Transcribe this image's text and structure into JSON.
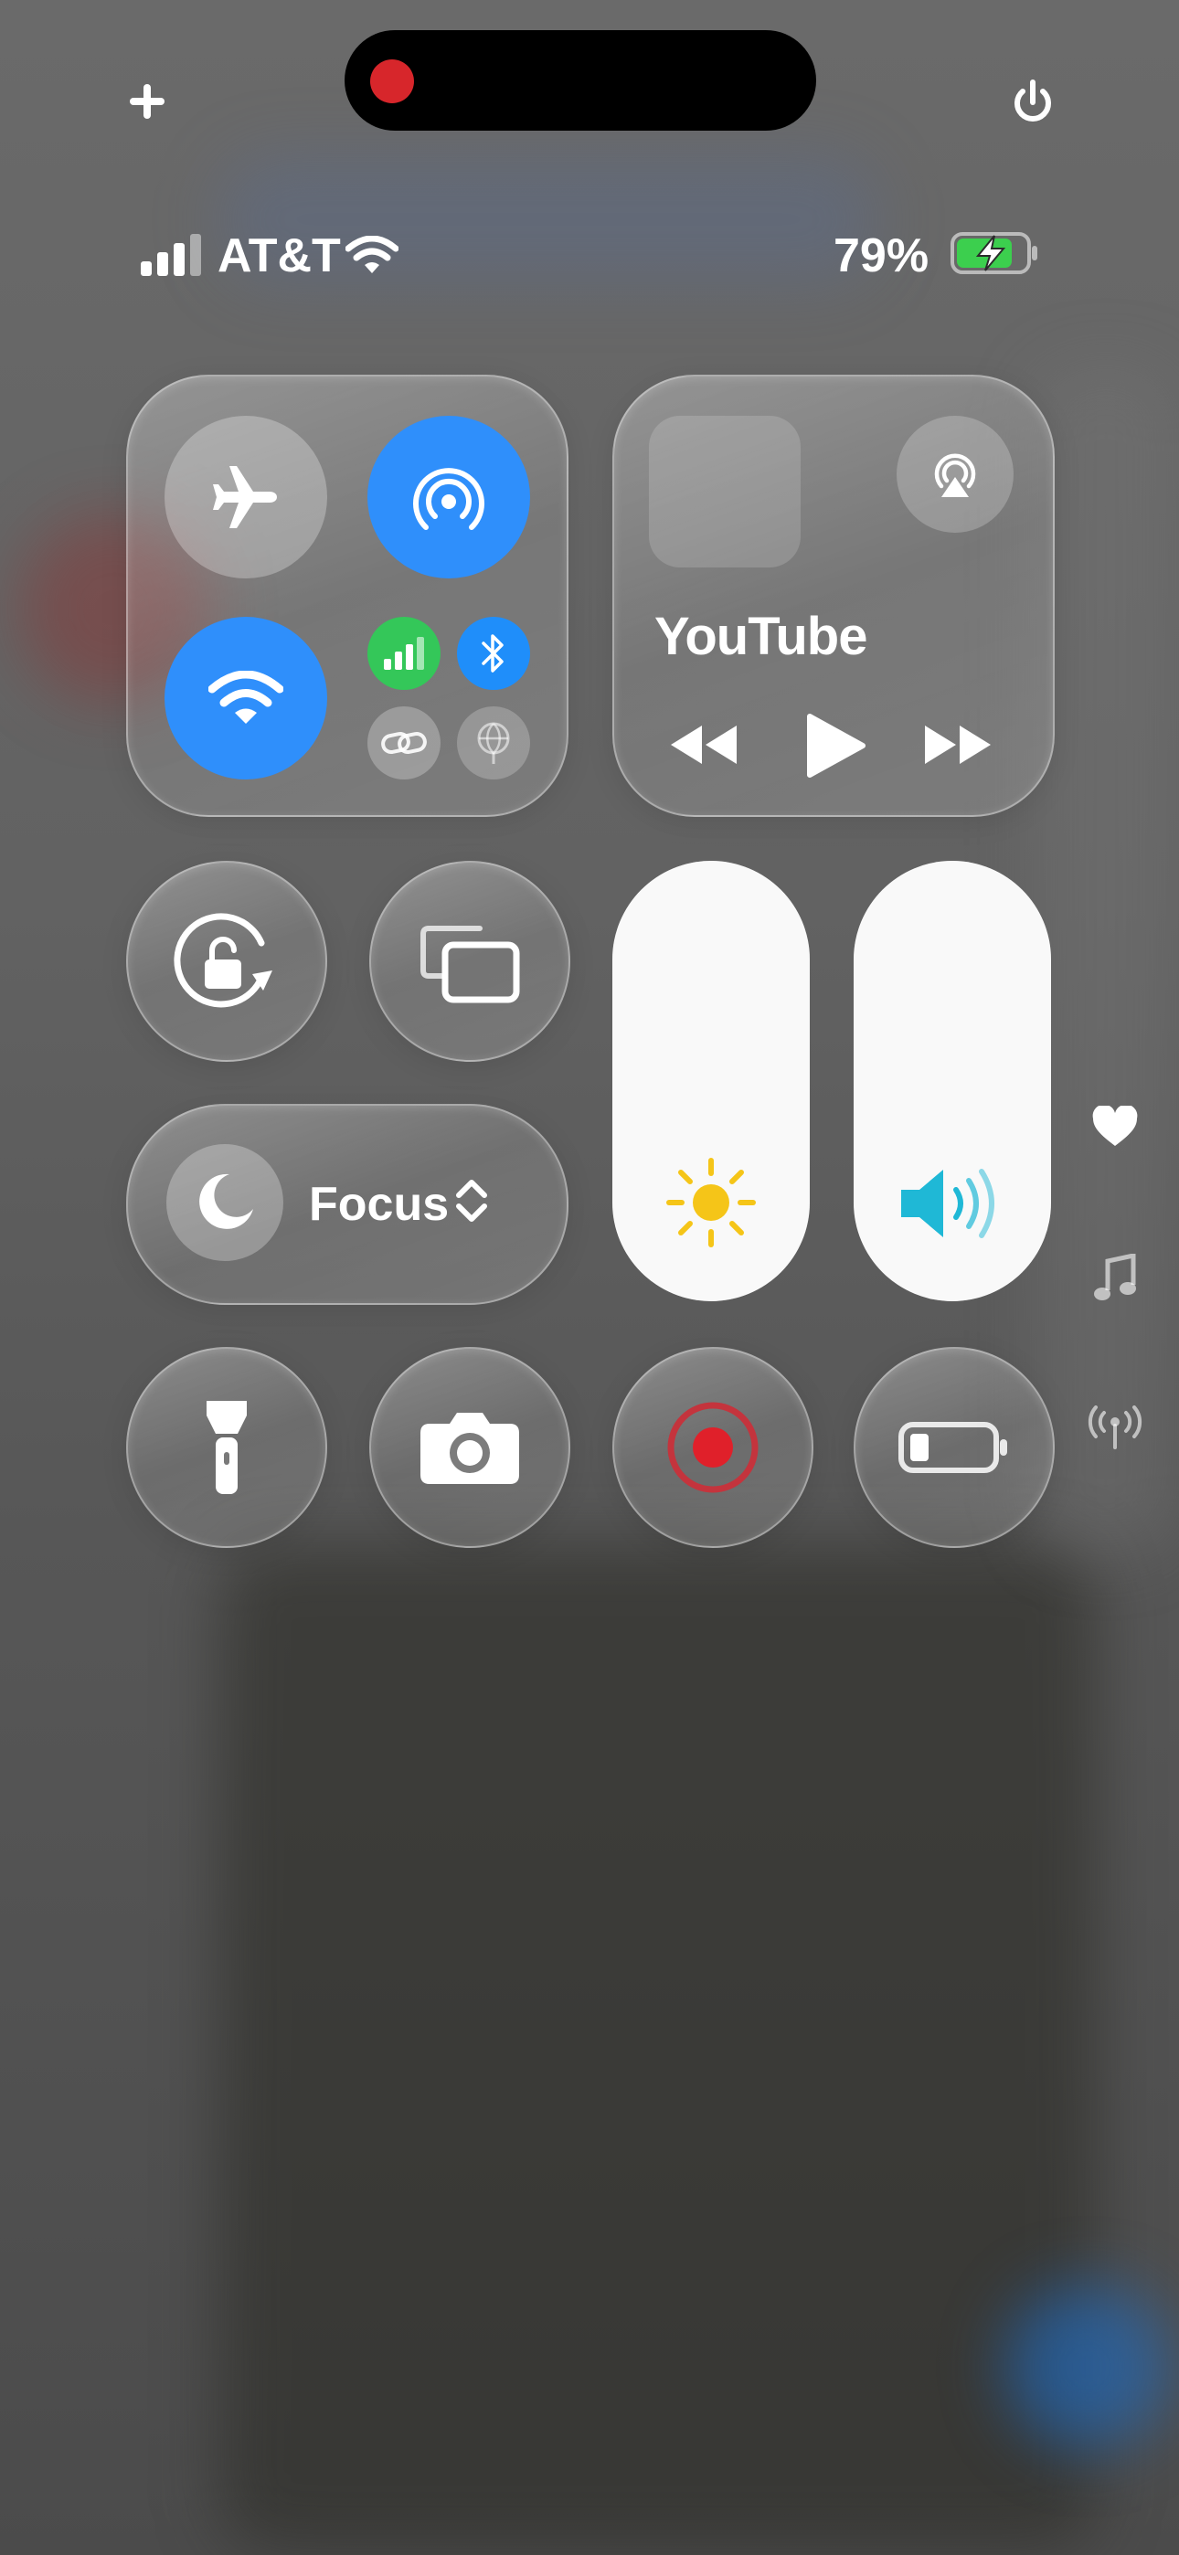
{
  "status_bar": {
    "carrier": "AT&T",
    "battery_percent": "79%",
    "battery_level": 0.79,
    "charging": true,
    "signal_bars": 3
  },
  "top_controls": {
    "add_icon": "plus-icon",
    "power_icon": "power-icon",
    "recording_indicator": "screen-recording-dot"
  },
  "connectivity": {
    "airplane_mode": {
      "icon": "airplane-icon",
      "active": false
    },
    "airdrop": {
      "icon": "airdrop-icon",
      "active": true
    },
    "wifi": {
      "icon": "wifi-icon",
      "active": true
    },
    "cellular": {
      "icon": "cellular-icon",
      "active": true,
      "color": "#34c759"
    },
    "bluetooth": {
      "icon": "bluetooth-icon",
      "active": true,
      "color": "#1f8efa"
    },
    "personal_hotspot": {
      "icon": "link-icon",
      "active": false
    },
    "satellite": {
      "icon": "globe-icon",
      "active": false
    }
  },
  "now_playing": {
    "app": "YouTube",
    "airplay_icon": "airplay-icon",
    "controls": [
      "rewind-icon",
      "play-icon",
      "fast-forward-icon"
    ]
  },
  "focus": {
    "label": "Focus",
    "icon": "moon-icon"
  },
  "sliders": {
    "brightness": {
      "icon": "sun-icon",
      "level": 1.0,
      "icon_color": "#f5c518"
    },
    "volume": {
      "icon": "speaker-icon",
      "level": 1.0,
      "icon_color": "#1fb8d6"
    }
  },
  "bottom_controls": [
    {
      "name": "flashlight-icon"
    },
    {
      "name": "camera-icon"
    },
    {
      "name": "screen-record-icon",
      "color": "#e0202a"
    },
    {
      "name": "low-power-mode-icon"
    }
  ],
  "side_indicators": [
    "heart-icon",
    "music-note-icon",
    "antenna-icon"
  ],
  "colors": {
    "accent": "#2f8ffb",
    "active_circle": "#2f8ffb"
  }
}
